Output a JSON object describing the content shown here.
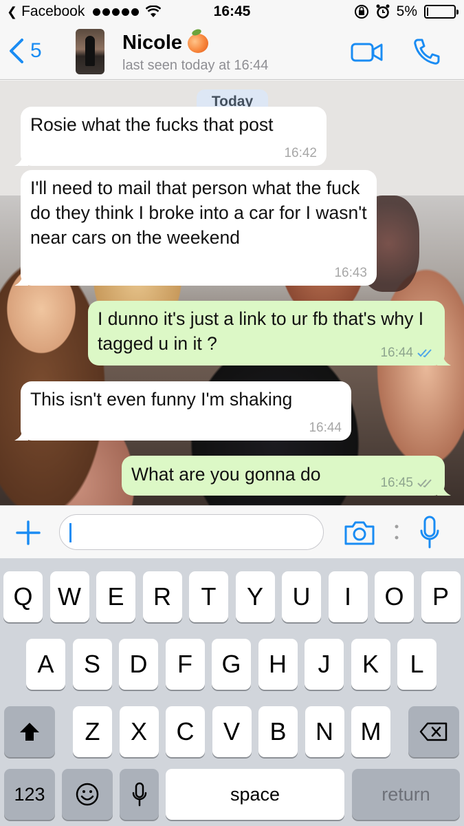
{
  "status_bar": {
    "back_app": "Facebook",
    "time": "16:45",
    "battery": "5%",
    "battery_level": 0.05
  },
  "header": {
    "back_count": "5",
    "contact_name": "Nicole",
    "contact_emoji": "peach-emoji",
    "last_seen": "last seen today at 16:44"
  },
  "chat": {
    "date_label": "Today",
    "messages": [
      {
        "direction": "in",
        "text": "Rosie what the fucks that post",
        "time": "16:42"
      },
      {
        "direction": "in",
        "text": "I'll need to mail that person what the fuck do they think I broke into a car for I wasn't near cars on the weekend",
        "time": "16:43"
      },
      {
        "direction": "out",
        "text": "I dunno it's just a link to ur fb that's why I tagged u in it ?",
        "time": "16:44",
        "status": "read"
      },
      {
        "direction": "in",
        "text": "This isn't even funny I'm shaking",
        "time": "16:44"
      },
      {
        "direction": "out",
        "text": "What are you gonna do",
        "time": "16:45",
        "status": "delivered"
      }
    ]
  },
  "input": {
    "value": "",
    "icons": [
      "plus-icon",
      "camera-icon",
      "more-dots-icon",
      "microphone-icon"
    ]
  },
  "keyboard": {
    "row1": [
      "Q",
      "W",
      "E",
      "R",
      "T",
      "Y",
      "U",
      "I",
      "O",
      "P"
    ],
    "row2": [
      "A",
      "S",
      "D",
      "F",
      "G",
      "H",
      "J",
      "K",
      "L"
    ],
    "row3": [
      "Z",
      "X",
      "C",
      "V",
      "B",
      "N",
      "M"
    ],
    "numbers_label": "123",
    "space_label": "space",
    "return_label": "return"
  },
  "colors": {
    "accent": "#1a8cf3",
    "incoming_bubble": "#ffffff",
    "outgoing_bubble": "#dcf8c6",
    "read_ticks": "#4fa6e8",
    "delivered_ticks": "#9aaa9a"
  }
}
